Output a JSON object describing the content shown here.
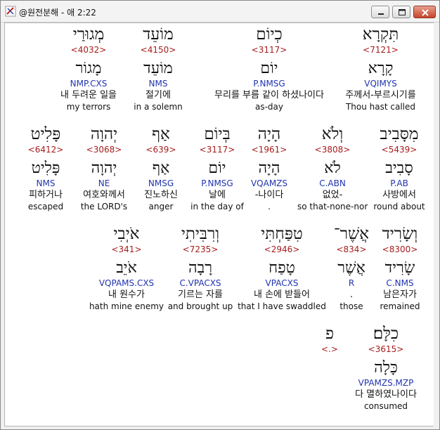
{
  "window": {
    "title": "@원전분해 - 애 2:22",
    "buttons": [
      "minimize-icon",
      "maximize-icon",
      "close-icon"
    ]
  },
  "rows": [
    {
      "words": [
        {
          "surface": "תִּקְרָא",
          "strong": "<7121>",
          "lemma": "קָרָא",
          "morph": "VQIMYS",
          "korean": "주께서-부르시기를",
          "english": "Thou hast called",
          "highlighted": true
        },
        {
          "surface": "כְיוֹם",
          "strong": "<3117>",
          "lemma": "יוֹם",
          "morph": "P.NMSG",
          "korean": "무리를 부름 같이 하셨나이다",
          "english": "as-day"
        },
        {
          "surface": "מוֹעֵד",
          "strong": "<4150>",
          "lemma": "מוֹעֵד",
          "morph": "NMS",
          "korean": "절기에",
          "english": "in a solemn"
        },
        {
          "surface": "מְגוּרַי",
          "strong": "<4032>",
          "lemma": "מָגוֹר",
          "morph": "NMP.CXS",
          "korean": "내 두려운 일을",
          "english": "my terrors"
        }
      ]
    },
    {
      "words": [
        {
          "surface": "מִסָּבִיב",
          "strong": "<5439>",
          "lemma": "סָבִיב",
          "morph": "P.AB",
          "korean": "사방에서",
          "english": "round about"
        },
        {
          "surface": "וְלֹא",
          "strong": "<3808>",
          "lemma": "לֹא",
          "morph": "C.ABN",
          "korean": "없었-",
          "english": "so that-none-nor"
        },
        {
          "surface": "הָיָה",
          "strong": "<1961>",
          "lemma": "הָיָה",
          "morph": "VQAMZS",
          "korean": "-나이다",
          "english": "."
        },
        {
          "surface": "בְּיוֹם",
          "strong": "<3117>",
          "lemma": "יוֹם",
          "morph": "P.NMSG",
          "korean": "날에",
          "english": "in the day of"
        },
        {
          "surface": "אַף",
          "strong": "<639>",
          "lemma": "אַף",
          "morph": "NMSG",
          "korean": "진노하신",
          "english": "anger"
        },
        {
          "surface": "יְהוָה",
          "strong": "<3068>",
          "lemma": "יְהוָה",
          "morph": "NE",
          "korean": "여호와께서",
          "english": "the LORD's"
        },
        {
          "surface": "פָּלִיט",
          "strong": "<6412>",
          "lemma": "פָּלִיט",
          "morph": "NMS",
          "korean": "피하거나",
          "english": "escaped"
        }
      ]
    },
    {
      "words": [
        {
          "surface": "וְשָׂרִיד",
          "strong": "<8300>",
          "lemma": "שָׂרִיד",
          "morph": "C.NMS",
          "korean": "남은자가",
          "english": "remained"
        },
        {
          "surface": "אֲשֶׁר־",
          "strong": "<834>",
          "lemma": "אֲשֶׁר",
          "morph": "R",
          "korean": ".",
          "english": "those"
        },
        {
          "surface": "טִפַּחְתִּי",
          "strong": "<2946>",
          "lemma": "טָפַח",
          "morph": "VPACXS",
          "korean": "내 손에 받들어",
          "english": "that I have swaddled"
        },
        {
          "surface": "וְרִבִּיתִי",
          "strong": "<7235>",
          "lemma": "רָבָה",
          "morph": "C.VPACXS",
          "korean": "기르는 자를",
          "english": "and brought up"
        },
        {
          "surface": "אֹיְבִי",
          "strong": "<341>",
          "lemma": "אֹיֵב",
          "morph": "VQPAMS.CXS",
          "korean": "내 원수가",
          "english": "hath mine enemy"
        }
      ]
    },
    {
      "words": [
        {
          "surface": "כִלָּם׃",
          "strong": "<3615>",
          "lemma": "כָּלָה",
          "morph": "VPAMZS.MZP",
          "korean": "다 멸하였나이다",
          "english": "consumed"
        },
        {
          "surface": "פ",
          "strong": "<.>",
          "lemma": "",
          "morph": "",
          "korean": "",
          "english": ""
        }
      ]
    }
  ]
}
